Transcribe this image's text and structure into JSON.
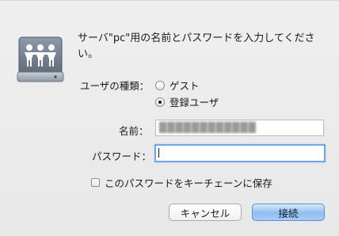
{
  "dialog": {
    "message": "サーバ\"pc\"用の名前とパスワードを入力してください。",
    "user_type_label": "ユーザの種類：",
    "user_type_options": [
      {
        "label": "ゲスト",
        "selected": false
      },
      {
        "label": "登録ユーザ",
        "selected": true
      }
    ],
    "name_label": "名前：",
    "name_value": "████████████",
    "password_label": "パスワード：",
    "password_value": "",
    "keychain_label": "このパスワードをキーチェーンに保存",
    "keychain_checked": false,
    "cancel_label": "キャンセル",
    "connect_label": "接続"
  },
  "icons": {
    "server": "network-server-icon"
  }
}
